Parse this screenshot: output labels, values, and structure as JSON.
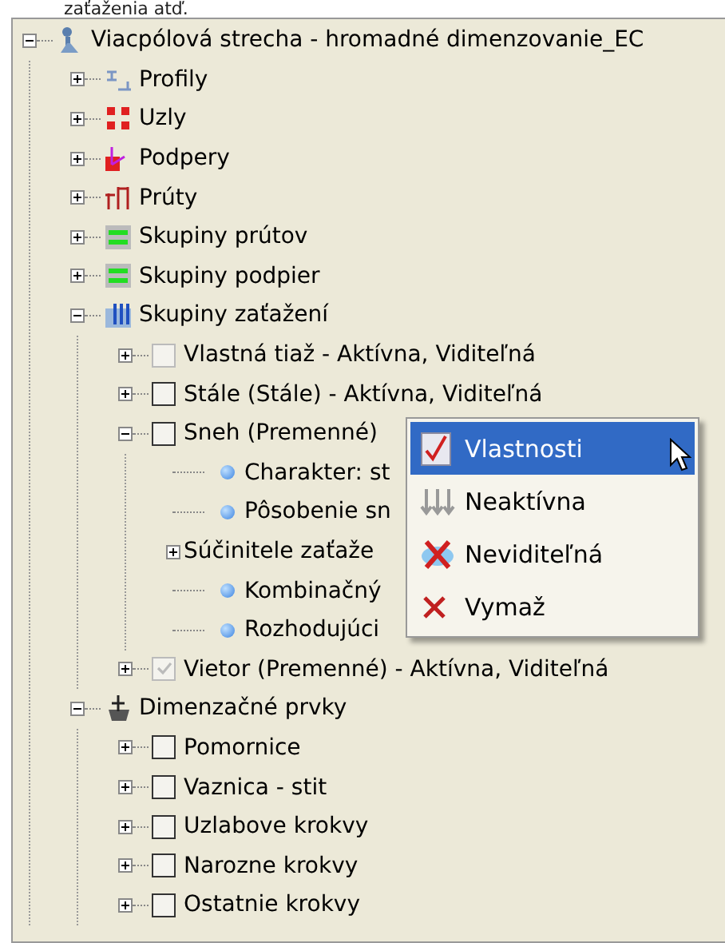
{
  "intro": "zaťaženia atď.",
  "tree": [
    {
      "kind": "model",
      "label": "Viacpólová strecha - hromadné dimenzovanie_EC",
      "expanded": true,
      "children": [
        {
          "kind": "profiles",
          "label": "Profily",
          "expanded": false
        },
        {
          "kind": "nodes",
          "label": "Uzly",
          "expanded": false
        },
        {
          "kind": "supports",
          "label": "Podpery",
          "expanded": false
        },
        {
          "kind": "members",
          "label": "Prúty",
          "expanded": false
        },
        {
          "kind": "group",
          "label": "Skupiny prútov",
          "expanded": false
        },
        {
          "kind": "group",
          "label": "Skupiny podpier",
          "expanded": false
        },
        {
          "kind": "loads",
          "label": "Skupiny zaťažení",
          "expanded": true,
          "children": [
            {
              "kind": "checkbox",
              "label": "Vlastná tiaž - Aktívna, Viditeľná",
              "expanded": false,
              "checked": false,
              "disabled": true
            },
            {
              "kind": "checkbox",
              "label": "Stále (Stále) - Aktívna, Viditeľná",
              "expanded": false,
              "checked": false,
              "disabled": false
            },
            {
              "kind": "checkbox",
              "label": "Sneh (Premenné)",
              "expanded": true,
              "checked": false,
              "disabled": false,
              "children": [
                {
                  "kind": "property",
                  "label": "Charakter: st"
                },
                {
                  "kind": "property",
                  "label": "Pôsobenie sn"
                },
                {
                  "kind": "plain",
                  "label": "Súčinitele zaťaže",
                  "expanded": false
                },
                {
                  "kind": "property",
                  "label": "Kombinačný"
                },
                {
                  "kind": "property",
                  "label": "Rozhodujúci"
                }
              ]
            },
            {
              "kind": "checkbox",
              "label": "Vietor (Premenné) - Aktívna, Viditeľná",
              "expanded": false,
              "checked": true,
              "disabled": true
            }
          ]
        },
        {
          "kind": "design",
          "label": "Dimenzačné prvky",
          "expanded": true,
          "children": [
            {
              "kind": "checkbox",
              "label": "Pomornice",
              "expanded": false,
              "checked": false,
              "disabled": false
            },
            {
              "kind": "checkbox",
              "label": "Vaznica - stit",
              "expanded": false,
              "checked": false,
              "disabled": false
            },
            {
              "kind": "checkbox",
              "label": "Uzlabove krokvy",
              "expanded": false,
              "checked": false,
              "disabled": false
            },
            {
              "kind": "checkbox",
              "label": "Narozne krokvy",
              "expanded": false,
              "checked": false,
              "disabled": false
            },
            {
              "kind": "checkbox",
              "label": "Ostatnie krokvy",
              "expanded": false,
              "checked": false,
              "disabled": false
            }
          ]
        }
      ]
    }
  ],
  "context_menu": [
    {
      "kind": "properties",
      "label": "Vlastnosti",
      "selected": true
    },
    {
      "kind": "inactive",
      "label": "Neaktívna",
      "selected": false
    },
    {
      "kind": "invisible",
      "label": "Neviditeľná",
      "selected": false
    },
    {
      "kind": "delete",
      "label": "Vymaž",
      "selected": false
    }
  ]
}
